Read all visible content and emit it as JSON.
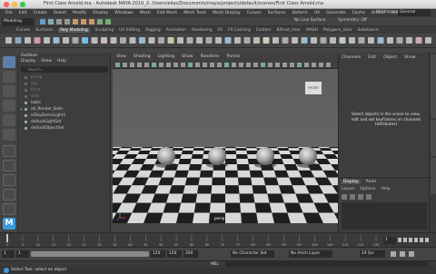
{
  "window": {
    "title": "First Class Arnold.ma - Autodesk MAYA 2019_2: /Users/elias/Documents/maya/projects/default/scenes/First Class Arnold.ma"
  },
  "menubar": [
    "File",
    "Edit",
    "Create",
    "Select",
    "Modify",
    "Display",
    "Windows",
    "Mesh",
    "Edit Mesh",
    "Mesh Tools",
    "Mesh Display",
    "Curves",
    "Surfaces",
    "Deform",
    "UV",
    "Generate",
    "Cache",
    "Arnold",
    "Help"
  ],
  "status": {
    "mode": "Modeling",
    "live_surface": "No Live Surface",
    "symmetry": "Symmetry: Off",
    "workspace_label": "Workspace:",
    "workspace_value": "General"
  },
  "shelf_tabs": [
    {
      "label": "Curves"
    },
    {
      "label": "Surfaces"
    },
    {
      "label": "Poly Modeling",
      "active": true
    },
    {
      "label": "Sculpting"
    },
    {
      "label": "UV Editing"
    },
    {
      "label": "Rigging"
    },
    {
      "label": "Animation"
    },
    {
      "label": "Rendering"
    },
    {
      "label": "FX"
    },
    {
      "label": "FX Caching"
    },
    {
      "label": "Custom"
    },
    {
      "label": "Bifrost_User"
    },
    {
      "label": "MASH"
    },
    {
      "label": "Polygons_User"
    },
    {
      "label": "Substance"
    }
  ],
  "outliner": {
    "title": "Outliner",
    "menu": [
      "Display",
      "Show",
      "Help"
    ],
    "search_placeholder": "Search...",
    "items": [
      {
        "label": "persp",
        "dim": true
      },
      {
        "label": "top",
        "dim": true
      },
      {
        "label": "front",
        "dim": true
      },
      {
        "label": "side",
        "dim": true
      },
      {
        "label": "table",
        "dim": false
      },
      {
        "label": "all_Render_Balls",
        "dim": false,
        "expand": true
      },
      {
        "label": "aiSkyDomeLight1",
        "dim": false
      },
      {
        "label": "defaultLightSet",
        "dim": false
      },
      {
        "label": "defaultObjectSet",
        "dim": false
      }
    ]
  },
  "viewport": {
    "menu": [
      "View",
      "Shading",
      "Lighting",
      "Show",
      "Renderer",
      "Panels"
    ],
    "camera": "persp",
    "viewcube": "FRONT"
  },
  "channelbox": {
    "tabs": [
      "Channels",
      "Edit",
      "Object",
      "Show"
    ],
    "message": "Select objects in the scene to view, edit and set keyframes on channels (attributes)"
  },
  "layer_editor": {
    "tabs": [
      "Display",
      "Anim"
    ],
    "menu": [
      "Layers",
      "Options",
      "Help"
    ]
  },
  "timeline": {
    "ticks": [
      "1",
      "5",
      "10",
      "15",
      "20",
      "25",
      "30",
      "35",
      "40",
      "45",
      "50",
      "55",
      "60",
      "65",
      "70",
      "75",
      "80",
      "85",
      "90",
      "95",
      "100",
      "105",
      "110",
      "115",
      "120"
    ],
    "current": "1",
    "range_start": "1",
    "range_inner_start": "1",
    "range_inner_end": "120",
    "range_end_a": "120",
    "range_end_b": "200",
    "char_set": "No Character Set",
    "anim_layer": "No Anim Layer",
    "fps": "24 fps"
  },
  "command_line": {
    "label": "MEL"
  },
  "help_line": {
    "text": "Select Tool: select an object"
  },
  "colors": {
    "accent": "#3d9ad8",
    "close": "#fc605c",
    "minimize": "#fdbc40",
    "zoom": "#34c84a"
  }
}
